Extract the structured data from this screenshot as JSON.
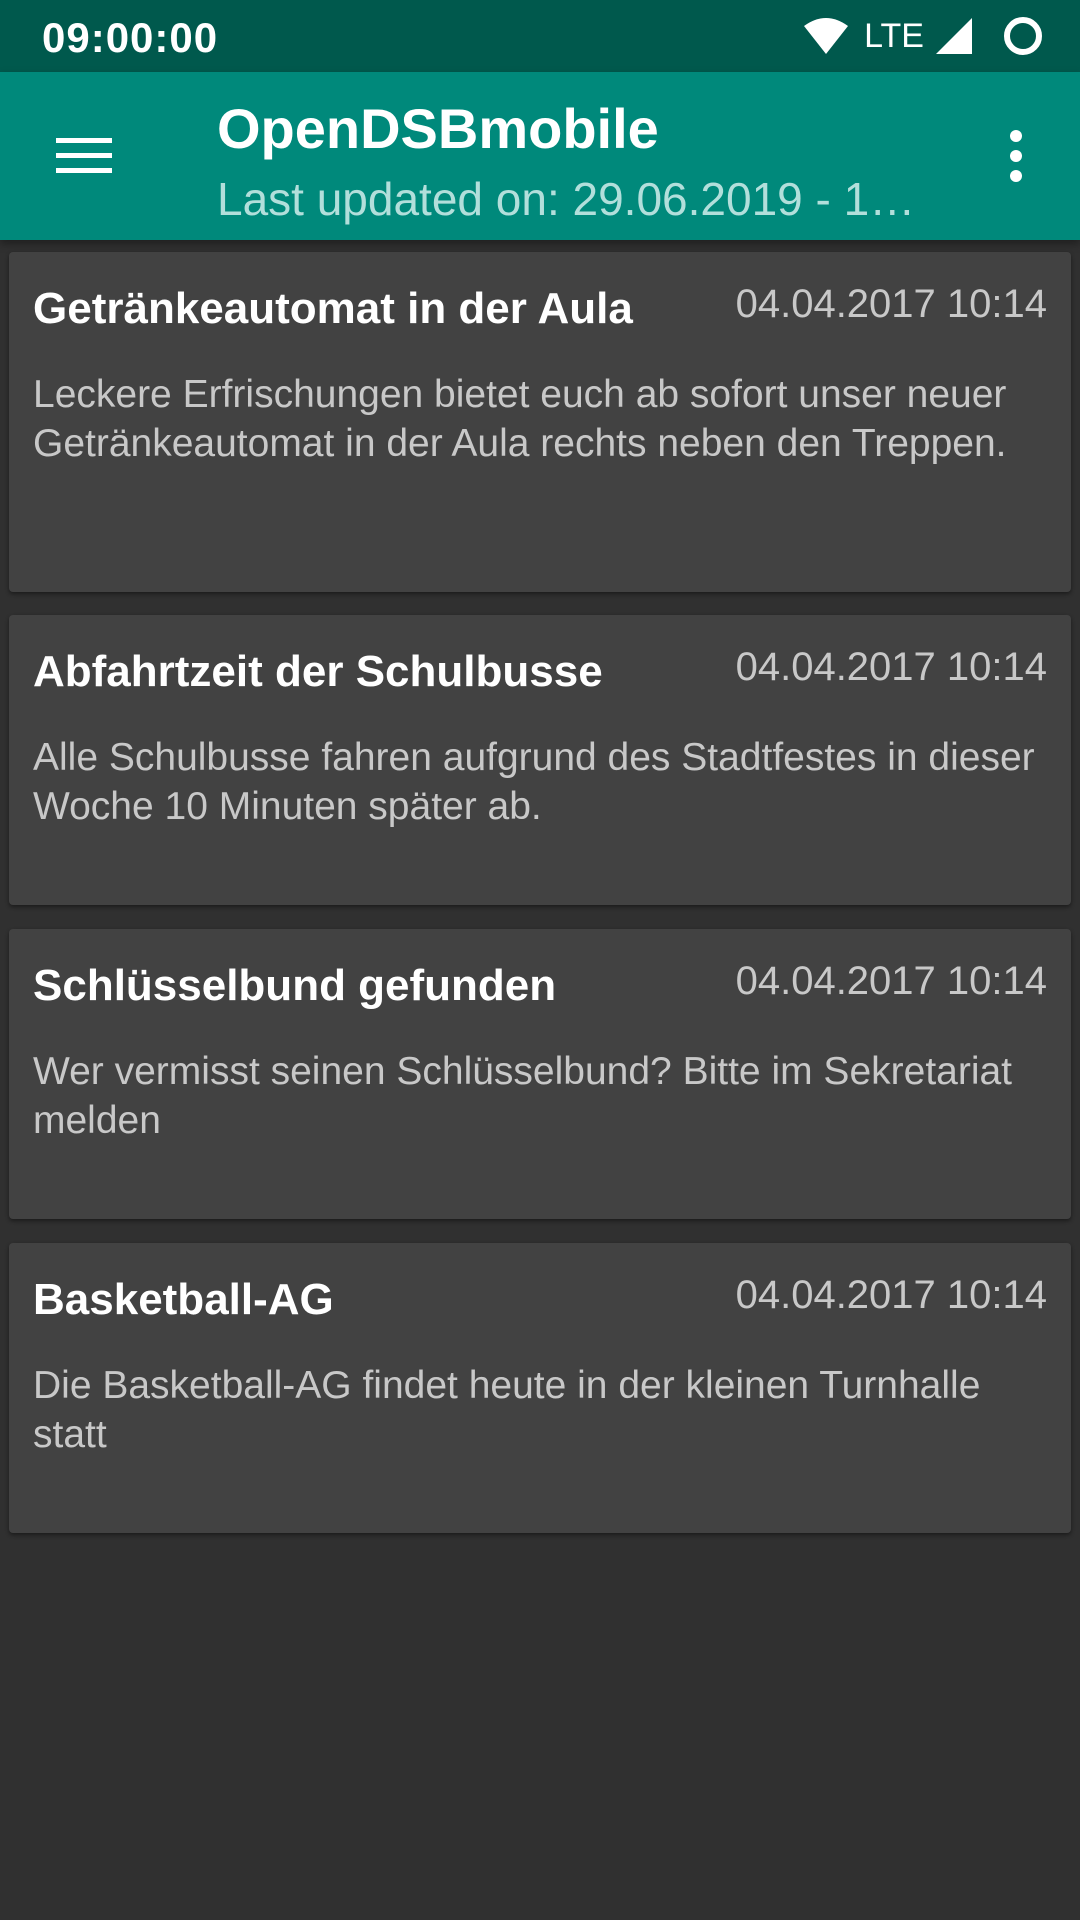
{
  "status_bar": {
    "time": "09:00:00",
    "network": "LTE",
    "icons": [
      "wifi-icon",
      "cell-signal-icon",
      "circle-indicator-icon"
    ]
  },
  "app_bar": {
    "title": "OpenDSBmobile",
    "subtitle": "Last updated on: 29.06.2019 - 1…",
    "menu_icon": "hamburger-menu-icon",
    "overflow_icon": "more-vertical-icon"
  },
  "news": [
    {
      "title": "Getränkeautomat in der Aula",
      "date": "04.04.2017 10:14",
      "body": "Leckere Erfrischungen bietet euch ab sofort unser neuer Getränkeautomat in der Aula rechts neben den Treppen."
    },
    {
      "title": "Abfahrtzeit der Schulbusse",
      "date": "04.04.2017 10:14",
      "body": "Alle Schulbusse fahren aufgrund des Stadtfestes in dieser Woche 10 Minuten später ab."
    },
    {
      "title": "Schlüsselbund gefunden",
      "date": "04.04.2017 10:14",
      "body": "Wer vermisst seinen Schlüsselbund? Bitte im Sekretariat melden"
    },
    {
      "title": "Basketball-AG",
      "date": "04.04.2017 10:14",
      "body": "Die Basketball-AG findet heute in der kleinen Turnhalle statt"
    }
  ],
  "colors": {
    "status_bar": "#00594d",
    "app_bar": "#00897b",
    "background": "#303030",
    "card": "#424242"
  }
}
